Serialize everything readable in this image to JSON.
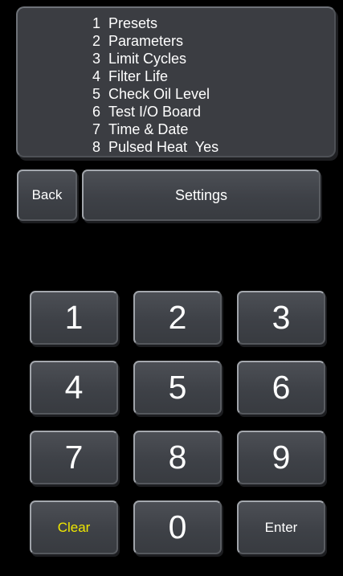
{
  "menu": {
    "items": [
      {
        "num": "1",
        "label": "Presets"
      },
      {
        "num": "2",
        "label": "Parameters"
      },
      {
        "num": "3",
        "label": "Limit Cycles"
      },
      {
        "num": "4",
        "label": "Filter Life"
      },
      {
        "num": "5",
        "label": "Check Oil Level"
      },
      {
        "num": "6",
        "label": "Test I/O Board"
      },
      {
        "num": "7",
        "label": "Time & Date"
      },
      {
        "num": "8",
        "label": "Pulsed Heat  Yes"
      }
    ]
  },
  "header": {
    "back_label": "Back",
    "title": "Settings"
  },
  "keypad": {
    "keys": [
      "1",
      "2",
      "3",
      "4",
      "5",
      "6",
      "7",
      "8",
      "9",
      "Clear",
      "0",
      "Enter"
    ],
    "clear_color": "#f0e800"
  }
}
